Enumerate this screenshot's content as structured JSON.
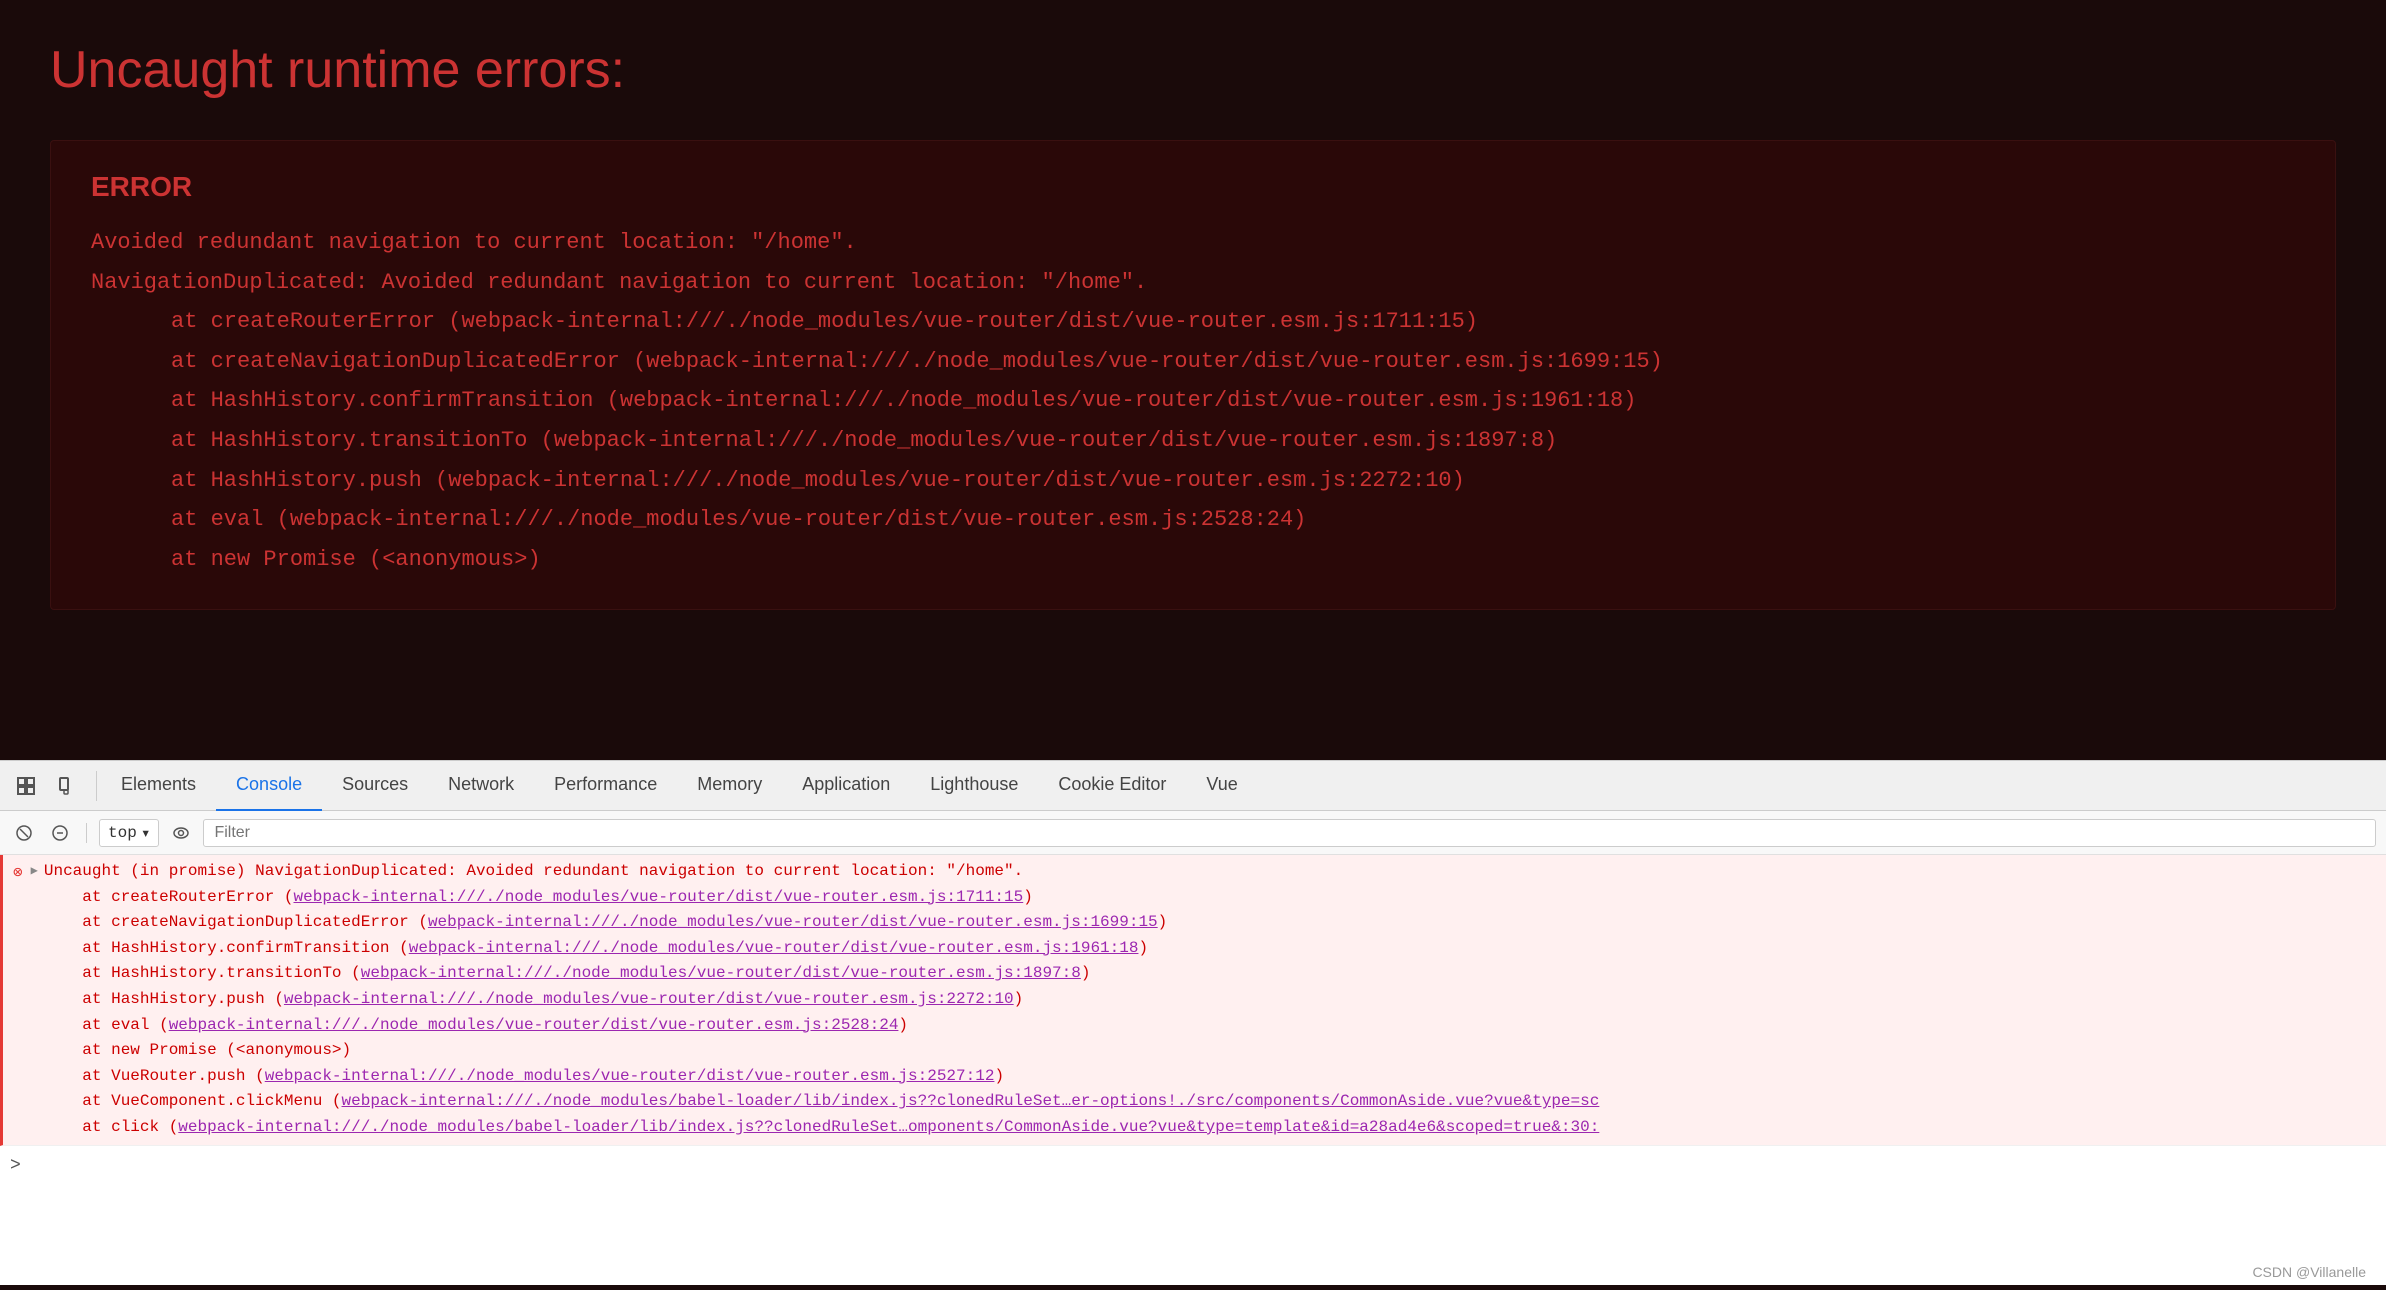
{
  "mainContent": {
    "title": "Uncaught runtime errors:",
    "errorBox": {
      "label": "ERROR",
      "lines": [
        "Avoided redundant navigation to current location: \"/home\".",
        "NavigationDuplicated: Avoided redundant navigation to current location: \"/home\".",
        "    at createRouterError (webpack-internal:///./node_modules/vue-router/dist/vue-router.esm.js:1711:15)",
        "    at createNavigationDuplicatedError (webpack-internal:///./node_modules/vue-router/dist/vue-router.esm.js:1699:15)",
        "    at HashHistory.confirmTransition (webpack-internal:///./node_modules/vue-router/dist/vue-router.esm.js:1961:18)",
        "    at HashHistory.transitionTo (webpack-internal:///./node_modules/vue-router/dist/vue-router.esm.js:1897:8)",
        "    at HashHistory.push (webpack-internal:///./node_modules/vue-router/dist/vue-router.esm.js:2272:10)",
        "    at eval (webpack-internal:///./node_modules/vue-router/dist/vue-router.esm.js:2528:24)",
        "    at new Promise (<anonymous>)"
      ]
    }
  },
  "devtools": {
    "tabs": [
      {
        "label": "Elements",
        "active": false
      },
      {
        "label": "Console",
        "active": true
      },
      {
        "label": "Sources",
        "active": false
      },
      {
        "label": "Network",
        "active": false
      },
      {
        "label": "Performance",
        "active": false
      },
      {
        "label": "Memory",
        "active": false
      },
      {
        "label": "Application",
        "active": false
      },
      {
        "label": "Lighthouse",
        "active": false
      },
      {
        "label": "Cookie Editor",
        "active": false
      },
      {
        "label": "Vue",
        "active": false
      }
    ],
    "toolbar": {
      "topLabel": "top",
      "filterPlaceholder": "Filter"
    },
    "consoleOutput": {
      "mainError": "Uncaught (in promise) NavigationDuplicated: Avoided redundant navigation to current location: \"/home\".",
      "stackLines": [
        {
          "prefix": "    at createRouterError (",
          "link": "webpack-internal:///./node_modules/vue-router/dist/vue-router.esm.js:1711:15",
          "suffix": ")"
        },
        {
          "prefix": "    at createNavigationDuplicatedError (",
          "link": "webpack-internal:///./node_modules/vue-router/dist/vue-router.esm.js:1699:15",
          "suffix": ")"
        },
        {
          "prefix": "    at HashHistory.confirmTransition (",
          "link": "webpack-internal:///./node_modules/vue-router/dist/vue-router.esm.js:1961:18",
          "suffix": ")"
        },
        {
          "prefix": "    at HashHistory.transitionTo (",
          "link": "webpack-internal:///./node_modules/vue-router/dist/vue-router.esm.js:1897:8",
          "suffix": ")"
        },
        {
          "prefix": "    at HashHistory.push (",
          "link": "webpack-internal:///./node_modules/vue-router/dist/vue-router.esm.js:2272:10",
          "suffix": ")"
        },
        {
          "prefix": "    at eval (",
          "link": "webpack-internal:///./node_modules/vue-router/dist/vue-router.esm.js:2528:24",
          "suffix": ")"
        },
        {
          "prefix": "    at new Promise (<anonymous>)",
          "link": "",
          "suffix": ""
        },
        {
          "prefix": "    at VueRouter.push (",
          "link": "webpack-internal:///./node_modules/vue-router/dist/vue-router.esm.js:2527:12",
          "suffix": ")"
        },
        {
          "prefix": "    at VueComponent.clickMenu (",
          "link": "webpack-internal:///./node_modules/babel-loader/lib/index.js??clonedRuleSet…er-options!./src/components/CommonAside.vue?vue&type=sc",
          "suffix": ""
        },
        {
          "prefix": "    at click (",
          "link": "webpack-internal:///./node_modules/babel-loader/lib/index.js??clonedRuleSet…omponents/CommonAside.vue?vue&type=template&id=a28ad4e6&scoped=true&:30:",
          "suffix": ""
        }
      ]
    }
  },
  "attribution": "CSDN @Villanelle"
}
